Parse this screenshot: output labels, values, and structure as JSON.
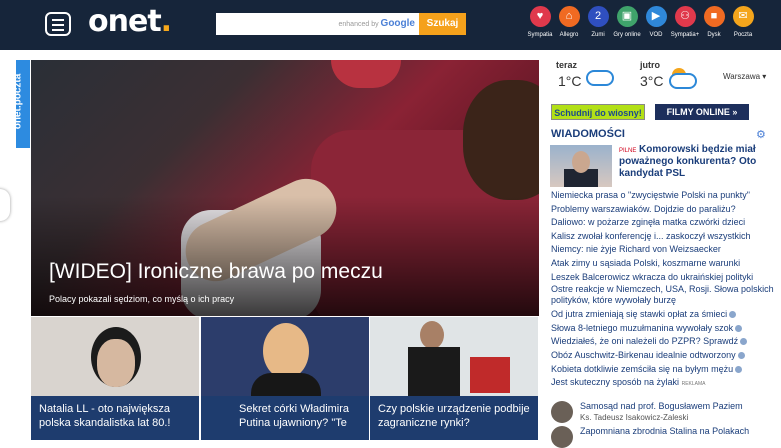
{
  "header": {
    "logo": "onet",
    "powered_by_prefix": "enhanced by",
    "powered_by_brand": "Google",
    "search_button": "Szukaj",
    "services": [
      {
        "label": "Sympatia",
        "icon": "heart-icon",
        "color": "#e0394c"
      },
      {
        "label": "Allegro",
        "icon": "basket-icon",
        "color": "#f06a22"
      },
      {
        "label": "Zumi",
        "icon": "zumi-icon",
        "color": "#2f4fbf"
      },
      {
        "label": "Gry online",
        "icon": "gamepad-icon",
        "color": "#3fa36b"
      },
      {
        "label": "VOD",
        "icon": "play-icon",
        "color": "#2f88d9"
      },
      {
        "label": "Sympatia+",
        "icon": "couple-icon",
        "color": "#e0394c"
      },
      {
        "label": "Dysk",
        "icon": "disk-icon",
        "color": "#f06a22"
      },
      {
        "label": "Poczta",
        "icon": "mail-icon",
        "color": "#f4a51c"
      }
    ]
  },
  "side_tab": "onet.poczta",
  "hero": {
    "title": "[WIDEO] Ironiczne brawa po meczu",
    "subtitle": "Polacy pokazali sędziom, co myślą o ich pracy"
  },
  "thumbs": [
    {
      "caption": "Natalia LL - oto największa polska skandalistka lat 80.!"
    },
    {
      "caption": "Sekret córki Władimira Putina ujawniony? \"Te"
    },
    {
      "caption": "Czy polskie urządzenie podbije zagraniczne rynki?"
    }
  ],
  "weather": {
    "today_label": "teraz",
    "today_temp": "1°C",
    "tomorrow_label": "jutro",
    "tomorrow_temp": "3°C",
    "city": "Warszawa"
  },
  "ads": {
    "left": "Schudnij do wiosny!",
    "right": "FILMY ONLINE »"
  },
  "news": {
    "heading": "WIADOMOŚCI",
    "lead_badge": "PILNE",
    "lead_title": "Komorowski będzie miał poważnego konkurenta? Oto kandydat PSL",
    "items": [
      "Niemiecka prasa o \"zwycięstwie Polski na punkty\"",
      "Problemy warszawiaków. Dojdzie do paraliżu?",
      "Daliowo: w pożarze zginęła matka czwórki dzieci",
      "Kalisz zwołał konferencję i... zaskoczył wszystkich",
      "Niemcy: nie żyje Richard von Weizsaecker",
      "Atak zimy u sąsiada Polski, koszmarne warunki",
      "Leszek Balcerowicz wkracza do ukraińskiej polityki",
      "Ostre reakcje w Niemczech, USA, Rosji. Słowa polskich polityków, które wywołały burzę",
      "Od jutra zmieniają się stawki opłat za śmieci",
      "Słowa 8-letniego muzułmanina wywołały szok",
      "Wiedziałeś, że oni należeli do PZPR? Sprawdź",
      "Obóz Auschwitz-Birkenau idealnie odtworzony",
      "Kobieta dotkliwie zemściła się na byłym mężu",
      "Jest skuteczny sposób na żylaki"
    ],
    "reklama": "REKLAMA",
    "bottom": [
      {
        "title": "Samosąd nad prof. Bogusławem Paziem",
        "author": "Ks. Tadeusz Isakowicz-Zaleski"
      },
      {
        "title": "Zapomniana zbrodnia Stalina na Polakach",
        "author": ""
      }
    ]
  }
}
